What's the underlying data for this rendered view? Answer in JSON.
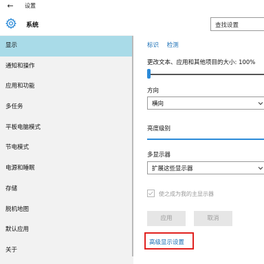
{
  "window": {
    "title": "设置",
    "back_icon": "back-arrow-icon"
  },
  "header": {
    "section_title": "系统",
    "icon": "gear-icon"
  },
  "search": {
    "placeholder": "查找设置"
  },
  "sidebar": {
    "items": [
      {
        "label": "显示",
        "active": true
      },
      {
        "label": "通知和操作",
        "active": false
      },
      {
        "label": "应用和功能",
        "active": false
      },
      {
        "label": "多任务",
        "active": false
      },
      {
        "label": "平板电脑模式",
        "active": false
      },
      {
        "label": "节电模式",
        "active": false
      },
      {
        "label": "电源和睡眠",
        "active": false
      },
      {
        "label": "存储",
        "active": false
      },
      {
        "label": "脱机地图",
        "active": false
      },
      {
        "label": "默认应用",
        "active": false
      },
      {
        "label": "关于",
        "active": false
      }
    ]
  },
  "display": {
    "links": [
      "标识",
      "检测"
    ],
    "scale_label": "更改文本、应用和其他项目的大小: 100%",
    "scale_value": 100,
    "orientation_label": "方向",
    "orientation_value": "横向",
    "brightness_label": "亮度级别",
    "multi_display_label": "多显示器",
    "multi_display_value": "扩展这些显示器",
    "main_display_checkbox": "使之成为我的主显示器",
    "apply_button": "应用",
    "cancel_button": "取消",
    "advanced_link": "高级显示设置"
  },
  "colors": {
    "active_nav": "#a9dbe8",
    "accent": "#2b8ad8",
    "link": "#1a6fb5",
    "highlight_box": "#e0201e"
  }
}
